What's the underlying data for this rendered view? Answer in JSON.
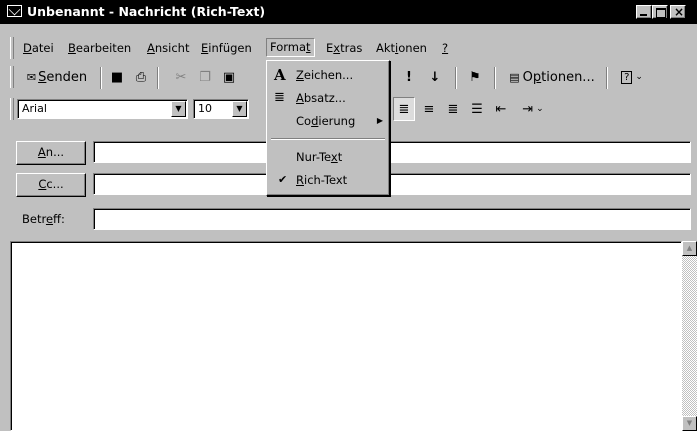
{
  "window": {
    "title": "Unbenannt - Nachricht (Rich-Text)"
  },
  "menubar": {
    "items": [
      {
        "pre": "",
        "key": "D",
        "post": "atei"
      },
      {
        "pre": "",
        "key": "B",
        "post": "earbeiten"
      },
      {
        "pre": "",
        "key": "A",
        "post": "nsicht"
      },
      {
        "pre": "",
        "key": "E",
        "post": "infügen"
      },
      {
        "pre": "Forma",
        "key": "t",
        "post": ""
      },
      {
        "pre": "E",
        "key": "x",
        "post": "tras"
      },
      {
        "pre": "Akt",
        "key": "i",
        "post": "onen"
      },
      {
        "pre": "",
        "key": "?",
        "post": ""
      }
    ]
  },
  "toolbar1": {
    "send": {
      "pre": "",
      "key": "S",
      "post": "enden"
    },
    "options": {
      "pre": "O",
      "key": "p",
      "post": "tionen..."
    }
  },
  "toolbar2": {
    "font": "Arial",
    "size": "10"
  },
  "address": {
    "to": {
      "pre": "",
      "key": "A",
      "post": "n..."
    },
    "cc": {
      "pre": "",
      "key": "C",
      "post": "c..."
    },
    "subject": {
      "pre": "Betr",
      "key": "e",
      "post": "ff:"
    }
  },
  "format_menu": {
    "items": [
      {
        "pre": "",
        "key": "Z",
        "post": "eichen...",
        "icon": "font-icon"
      },
      {
        "pre": "",
        "key": "A",
        "post": "bsatz...",
        "icon": "paragraph-icon"
      },
      {
        "pre": "Co",
        "key": "d",
        "post": "ierung",
        "icon": "submenu-arrow-icon"
      },
      {
        "pre": "Nur-Te",
        "key": "x",
        "post": "t",
        "icon": ""
      },
      {
        "pre": "",
        "key": "R",
        "post": "ich-Text",
        "icon": "checkmark-icon",
        "checked": true
      }
    ]
  }
}
